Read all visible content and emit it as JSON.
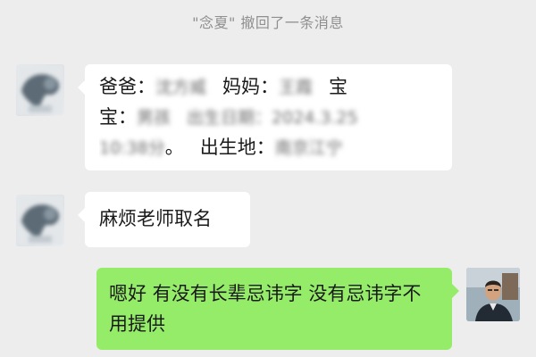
{
  "system_notice": "\"念夏\" 撤回了一条消息",
  "messages": [
    {
      "line1": {
        "dad_label": "爸爸：",
        "dad_name": "沈方威",
        "mom_label": "妈妈：",
        "mom_name": "王霞",
        "baby_prefix": "宝"
      },
      "line2": {
        "baby_suffix": "宝：",
        "gender": "男孩",
        "birth_label": "出生日期",
        "birth_value": "：2024.3.25"
      },
      "line3": {
        "time": "10:38分",
        "sep": "。",
        "place_label": "出生地：",
        "place_value": "南京江宁"
      }
    },
    {
      "text": "麻烦老师取名"
    },
    {
      "text": "嗯好 有没有长辈忌讳字 没有忌讳字不用提供"
    }
  ],
  "colors": {
    "background": "#ededed",
    "incoming_bubble": "#ffffff",
    "outgoing_bubble": "#95ec69",
    "notice_text": "#8f8f8f"
  }
}
